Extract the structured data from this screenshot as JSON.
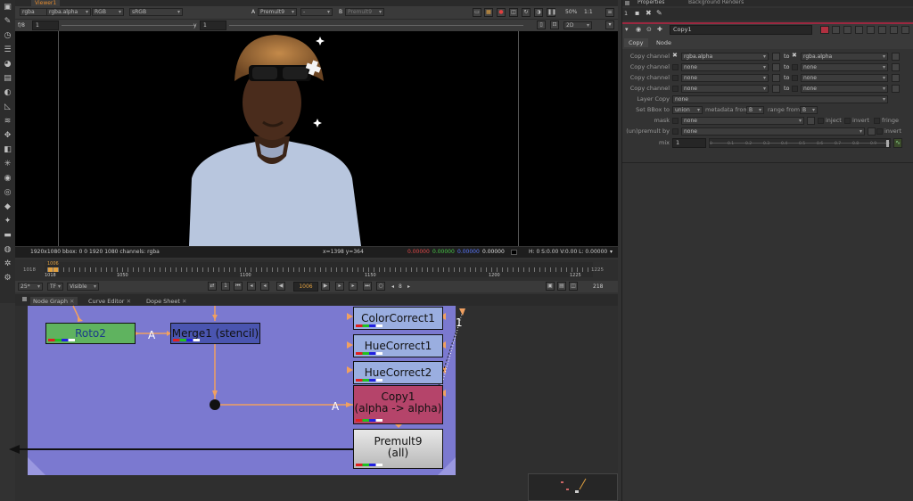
{
  "viewer": {
    "tab": "Viewer1",
    "channels": "rgba",
    "alpha_channel": "rgba.alpha",
    "display": "RGB",
    "colorspace": "sRGB",
    "input_a_label": "A",
    "input_a": "Premult9",
    "input_a_op": "-",
    "input_b_label": "B",
    "input_b": "Premult9",
    "zoom": "50%",
    "ratio": "1:1",
    "fstop_label": "f/8",
    "gain": "1",
    "gamma_label": "y",
    "gamma": "1",
    "view_mode": "2D",
    "info_left": "1920x1080  bbox: 0 0 1920 1080 channels: rgba",
    "coords": "x=1398 y=364",
    "r": "0.00000",
    "g": "0.00000",
    "b": "0.00000",
    "a": "0.00000",
    "hsv": "H:  0 S:0.00 V:0.00  L: 0.00000"
  },
  "timeline": {
    "start_label": "1018",
    "current_marker": "1006",
    "ticks": [
      "1018",
      "1050",
      "1100",
      "1150",
      "1200",
      "1225"
    ],
    "end_label": "1225",
    "fps": "25*",
    "tf": "TF",
    "visible": "Visible",
    "frame": "1006",
    "step": "8",
    "end_frame": "218"
  },
  "panels": {
    "tabs": [
      "Node Graph",
      "Curve Editor",
      "Dope Sheet"
    ]
  },
  "nodes": {
    "roto": "Roto2",
    "merge": "Merge1 (stencil)",
    "cc": "ColorCorrect1",
    "hue1": "HueCorrect1",
    "hue2": "HueCorrect2",
    "copy_title": "Copy1",
    "copy_sub": "(alpha -> alpha)",
    "premult_title": "Premult9",
    "premult_sub": "(all)",
    "edge_a1": "A",
    "edge_a2": "A",
    "edge_1": "1"
  },
  "properties": {
    "tab1": "Properties",
    "tab2": "Background Renders",
    "count": "1",
    "node_name": "Copy1",
    "subtabs": [
      "Copy",
      "Node"
    ],
    "rows": [
      {
        "label": "Copy channel",
        "from": "rgba.alpha",
        "to_label": "to",
        "to": "rgba.alpha"
      },
      {
        "label": "Copy channel",
        "from": "none",
        "to_label": "to",
        "to": "none"
      },
      {
        "label": "Copy channel",
        "from": "none",
        "to_label": "to",
        "to": "none"
      },
      {
        "label": "Copy channel",
        "from": "none",
        "to_label": "to",
        "to": "none"
      }
    ],
    "layer_copy_label": "Layer Copy",
    "layer_copy": "none",
    "bbox_label": "Set BBox to",
    "bbox": "union",
    "metadata_label": "metadata from",
    "metadata": "B",
    "range_label": "range from",
    "range": "B",
    "mask_label": "mask",
    "mask": "none",
    "inject": "inject",
    "invert": "invert",
    "fringe": "fringe",
    "unpremult_label": "(un)premult by",
    "unpremult": "none",
    "invert2": "invert",
    "mix_label": "mix",
    "mix": "1",
    "mix_ticks": [
      "0",
      "0.1",
      "0.2",
      "0.3",
      "0.4",
      "0.5",
      "0.6",
      "0.7",
      "0.8",
      "0.9",
      "1"
    ]
  },
  "colors": {
    "graph_bg": "#7b79d0",
    "roto": "#5fb35f",
    "merge": "#4a55b0",
    "copy": "#b5446a",
    "premult": "#cfcfcf",
    "edge": "#f0a060"
  }
}
